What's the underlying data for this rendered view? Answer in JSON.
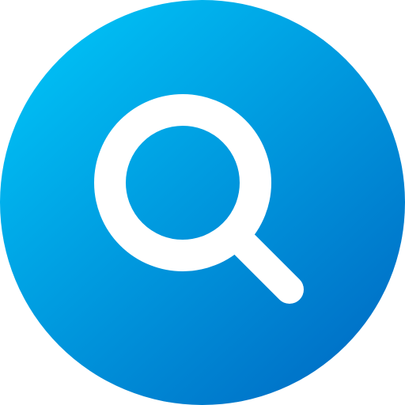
{
  "icon": {
    "name": "search-icon",
    "glyph_color": "#ffffff",
    "gradient": {
      "start": "#00c0f5",
      "end": "#006fc6"
    }
  }
}
